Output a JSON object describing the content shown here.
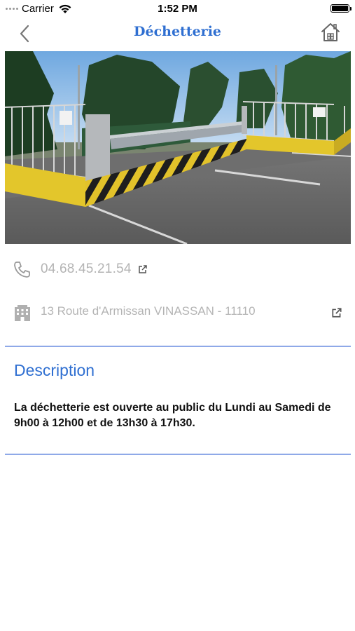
{
  "status_bar": {
    "carrier": "Carrier",
    "time": "1:52 PM",
    "icons": [
      "signal-dots-icon",
      "wifi-icon",
      "battery-icon"
    ]
  },
  "nav": {
    "title": "Déchetterie",
    "back_icon": "chevron-left-icon",
    "home_icon": "home-icon"
  },
  "hero": {
    "description_icon": "photo"
  },
  "contact": {
    "phone": "04.68.45.21.54",
    "phone_icon": "phone-icon",
    "address": "13 Route d'Armissan VINASSAN - 11110",
    "address_icon": "building-icon",
    "external_link_icon": "external-link-icon"
  },
  "description": {
    "heading": "Description",
    "body": "La déchetterie est ouverte au public du Lundi au Samedi de 9h00 à 12h00 et de 13h30 à 17h30."
  },
  "colors": {
    "accent": "#2f6fd1",
    "divider": "#8fa9e8",
    "muted_text": "#b4b4b4"
  }
}
